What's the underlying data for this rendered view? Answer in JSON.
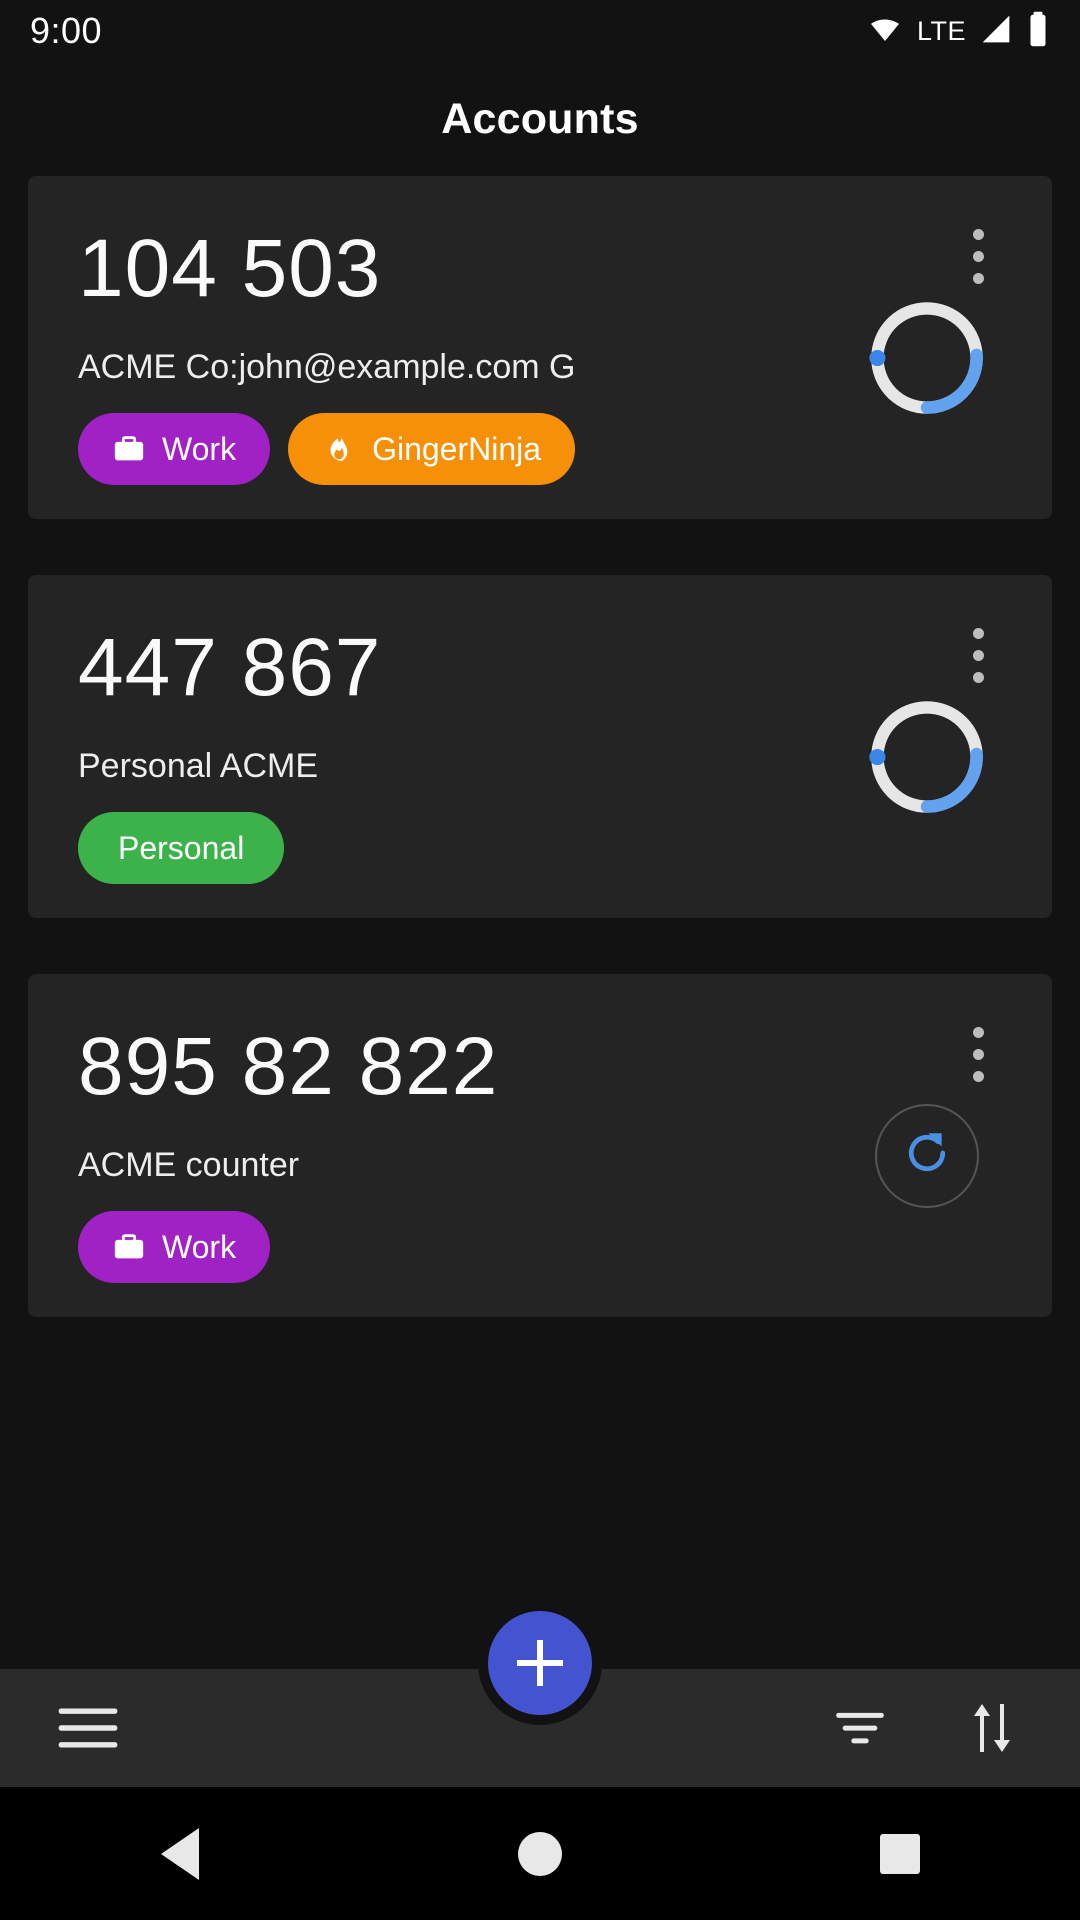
{
  "statusbar": {
    "time": "9:00",
    "network_label": "LTE",
    "icons": [
      "wifi-icon",
      "cellular-signal-icon",
      "battery-icon"
    ]
  },
  "appbar": {
    "title": "Accounts"
  },
  "colors": {
    "background": "#121212",
    "card": "#242424",
    "bottom_bar": "#2b2b2b",
    "fab": "#4453cf",
    "progress_track": "#e6e6e6",
    "progress_arc": "#63a2ef",
    "progress_dot": "#3a86e8",
    "refresh_blue": "#4a90e2",
    "chip_work": "#a021c4",
    "chip_gingerninja": "#f79009",
    "chip_personal": "#3cb34a"
  },
  "accounts": [
    {
      "code": "104 503",
      "subtitle": "ACME Co:john@example.com G",
      "chips": [
        {
          "label": "Work",
          "color": "#a021c4",
          "icon": "briefcase-icon"
        },
        {
          "label": "GingerNinja",
          "color": "#f79009",
          "icon": "flame-icon"
        }
      ],
      "indicator": "progress-ring",
      "progress_percent": 26,
      "menu_icon": "overflow-menu-icon"
    },
    {
      "code": "447 867",
      "subtitle": "Personal ACME",
      "chips": [
        {
          "label": "Personal",
          "color": "#3cb34a",
          "icon": ""
        }
      ],
      "indicator": "progress-ring",
      "progress_percent": 26,
      "menu_icon": "overflow-menu-icon"
    },
    {
      "code": "895 82 822",
      "subtitle": "ACME counter",
      "chips": [
        {
          "label": "Work",
          "color": "#a021c4",
          "icon": "briefcase-icon"
        }
      ],
      "indicator": "refresh-button",
      "progress_percent": 0,
      "menu_icon": "overflow-menu-icon"
    }
  ],
  "bottombar": {
    "menu_icon": "hamburger-menu-icon",
    "filter_icon": "filter-icon",
    "sort_icon": "sort-icon",
    "fab_icon": "plus-icon"
  },
  "navbar": {
    "back_icon": "back-triangle-icon",
    "home_icon": "home-circle-icon",
    "recents_icon": "recents-square-icon"
  }
}
